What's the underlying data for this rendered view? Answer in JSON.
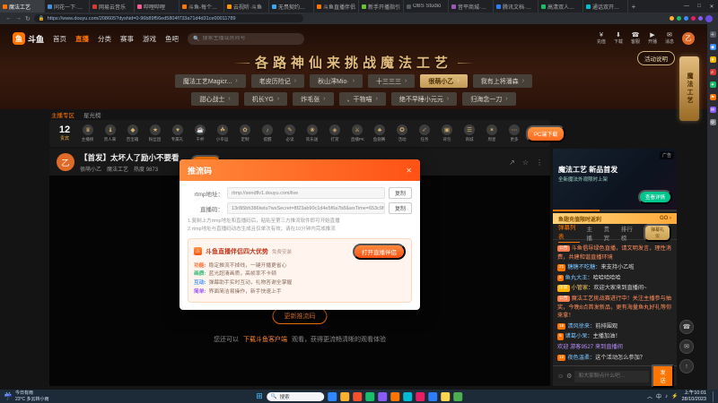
{
  "browser": {
    "tabs": [
      {
        "title": "魔法工艺",
        "color": "#ff7500",
        "active": true
      },
      {
        "title": "同花一下·直播中心",
        "color": "#4a90d9"
      },
      {
        "title": "网易云音乐",
        "color": "#d33a31"
      },
      {
        "title": "哔哩哔哩",
        "color": "#f25d8e"
      },
      {
        "title": "斗鱼-每个人的直播",
        "color": "#ff7500"
      },
      {
        "title": "云视听·斗鱼",
        "color": "#ff9500"
      },
      {
        "title": "无畏契约赛事中心",
        "color": "#3ba3f0"
      },
      {
        "title": "斗鱼直播伴侣",
        "color": "#ff7500"
      },
      {
        "title": "新手开播指引",
        "color": "#67c23a"
      },
      {
        "title": "OBS Studio",
        "color": "#555a60"
      },
      {
        "title": "音平商城·声卡调试",
        "color": "#9b59b6"
      },
      {
        "title": "腾讯文档·值班表",
        "color": "#2e7cf6"
      },
      {
        "title": "高清双人素材(4K)",
        "color": "#19be6b"
      },
      {
        "title": "通话双开模式(48)",
        "color": "#00bcd4"
      }
    ],
    "new_tab": "+",
    "window_controls": [
      "—",
      "□",
      "✕"
    ],
    "address": {
      "back": "←",
      "forward": "→",
      "refresh": "↻",
      "lock": "🔒",
      "url": "https://www.douyu.com/208605?dyshid=0-96b89f56ed5804f733a71d4d31ce00011789"
    },
    "extensions": [
      "#ffb02e",
      "#19be6b",
      "#3b8cff",
      "#e91e63",
      "#8a5cf6"
    ]
  },
  "nav": {
    "logo_glyph": "鱼",
    "logo": "斗鱼",
    "menu": [
      {
        "label": "首页"
      },
      {
        "label": "直播",
        "active": true
      },
      {
        "label": "分类"
      },
      {
        "label": "赛事"
      },
      {
        "label": "游戏"
      },
      {
        "label": "鱼吧"
      }
    ],
    "search_placeholder": "搜索主播或房间号",
    "actions": [
      {
        "label": "充值",
        "glyph": "¥"
      },
      {
        "label": "下载",
        "glyph": "⬇"
      },
      {
        "label": "客服",
        "glyph": "☎"
      },
      {
        "label": "开播",
        "glyph": "▶"
      },
      {
        "label": "消息",
        "glyph": "✉"
      }
    ],
    "avatar": "乙"
  },
  "banner": {
    "title": "各路神仙来挑战魔法工艺",
    "activity_button": "活动说明"
  },
  "anchor_tabs": {
    "row1": [
      {
        "label": "魔法工艺Magicr..."
      },
      {
        "label": "老皮历险记"
      },
      {
        "label": "秋山澪Mio·"
      },
      {
        "label": "十三三三"
      },
      {
        "label": "很萌小乙",
        "active": true
      },
      {
        "label": "我有上将潘森"
      }
    ],
    "row2": [
      {
        "label": "甜心战士"
      },
      {
        "label": "机长YG"
      },
      {
        "label": "炸毛张"
      },
      {
        "label": "、干物喵"
      },
      {
        "label": "绝不早睡小元元"
      },
      {
        "label": "归海念一刀"
      }
    ],
    "arrow": "›"
  },
  "strip": {
    "items": [
      {
        "label": "主播专区",
        "active": true
      },
      {
        "label": "星光榜"
      }
    ]
  },
  "feature_bar": {
    "rank": "12",
    "rank_label": "贵宾",
    "items": [
      {
        "label": "主播榜",
        "glyph": "♛"
      },
      {
        "label": "贵人来",
        "glyph": "♝"
      },
      {
        "label": "百宝箱",
        "glyph": "◆"
      },
      {
        "label": "粉丝团",
        "glyph": "★"
      },
      {
        "label": "专属礼",
        "glyph": "♥"
      },
      {
        "label": "干杯",
        "glyph": "☕"
      },
      {
        "label": "小幸运",
        "glyph": "☘"
      },
      {
        "label": "定制",
        "glyph": "✿"
      },
      {
        "label": "提醒",
        "glyph": "♪"
      },
      {
        "label": "必读",
        "glyph": "✎"
      },
      {
        "label": "欢乐送",
        "glyph": "❀"
      },
      {
        "label": "打赏",
        "glyph": "◈"
      },
      {
        "label": "直播PK",
        "glyph": "⚔"
      },
      {
        "label": "鱼翅赛",
        "glyph": "♣"
      },
      {
        "label": "活动",
        "glyph": "✪"
      },
      {
        "label": "任务",
        "glyph": "✓"
      },
      {
        "label": "背包",
        "glyph": "▣"
      },
      {
        "label": "商城",
        "glyph": "☰"
      },
      {
        "label": "周星",
        "glyph": "✶"
      },
      {
        "label": "更多",
        "glyph": "⋯"
      }
    ],
    "pc_button": "PC端下载"
  },
  "player": {
    "header": {
      "avatar": "乙",
      "title": "【首发】太坏人了励小不要看",
      "follow": "+ 关注",
      "anchor": "很萌小乙",
      "category": "魔法工艺",
      "heat": "热度 9873",
      "tools": [
        {
          "glyph": "↗"
        },
        {
          "glyph": "☆"
        },
        {
          "glyph": "⋮"
        }
      ]
    },
    "offline": {
      "refresh_button": "更新推流码",
      "tip_prefix": "您还可以",
      "tip_link": "下载斗鱼客户端",
      "tip_suffix": "观看，获得更流畅清晰的观看体验"
    }
  },
  "modal": {
    "title": "推流码",
    "close": "✕",
    "fields": [
      {
        "label": "rtmp地址：",
        "value": "rtmp://sendflv1.douyu.com/live",
        "copy": "复制"
      },
      {
        "label": "直播码：",
        "value": "13r8i5bh386twtu?wsSecret=8f23ab90c1d4e5f6a7b8&wsTime=653c9f2e",
        "copy": "复制"
      }
    ],
    "tips": [
      "1.复制上方rtmp地址和直播码后，粘贴至第三方推流软件即可开始直播",
      "2.rtmp地址与直播码动态生成且仅单次有效，请在10分钟内完成推流"
    ],
    "promo": {
      "flame": "♨",
      "title": "斗鱼直播伴侣四大优势",
      "subtitle": "免费安装",
      "button": "打开直播伴侣",
      "lines": [
        {
          "tag": "功能:",
          "color": "#ff6a2b",
          "text": "稳定推流不掉线，一键开播更省心"
        },
        {
          "tag": "画质:",
          "color": "#2eb872",
          "text": "蓝光超清画质，高帧率不卡顿"
        },
        {
          "tag": "互动:",
          "color": "#3b8cff",
          "text": "弹幕助手实时互动，礼物答谢全掌握"
        },
        {
          "tag": "简单:",
          "color": "#a45bff",
          "text": "界面简洁易操作，新手快速上手"
        }
      ]
    }
  },
  "sidebar": {
    "ad": {
      "badge": "广告",
      "title": "魔法工艺 新品首发",
      "subtitle": "全新魔法外观限时上架",
      "cta": "查看详情",
      "progress_style": "width:38%"
    },
    "promo_bar": {
      "text": "鱼翅充值限时返利",
      "cta": "GO ›"
    },
    "tabs": [
      {
        "label": "弹幕列表",
        "active": true
      },
      {
        "label": "主播"
      },
      {
        "label": "贵宾"
      },
      {
        "label": "排行榜"
      }
    ],
    "etiquette_button": "弹幕礼仪",
    "messages": [
      {
        "badge": "公告",
        "badgeBg": "#ff7d4c",
        "name": "",
        "nameColor": "#ff8d5a",
        "text": "斗鱼倡导绿色直播，请文明发言，理性消费，共建和谐直播环境",
        "textColor": "#ff8d5a"
      },
      {
        "badge": "21",
        "badgeBg": "#ff7500",
        "name": "糖糖不吃糖：",
        "nameColor": "#7ac6ff",
        "text": "来支持小乙啦",
        "textColor": "#dddddd"
      },
      {
        "badge": "8",
        "badgeBg": "#ff7500",
        "name": "鱼丸大王：",
        "nameColor": "#7ac6ff",
        "text": "哈哈哈哈哈",
        "textColor": "#dddddd"
      },
      {
        "badge": "房管",
        "badgeBg": "#ffb400",
        "name": "小管家：",
        "nameColor": "#ffc966",
        "text": "欢迎大家来到直播间~",
        "textColor": "#dddddd"
      },
      {
        "badge": "公告",
        "badgeBg": "#ff7d4c",
        "name": "",
        "nameColor": "#ff8d5a",
        "text": "魔法工艺挑战赛进行中！关注主播参与抽奖，今晚8点首发新品，更有海量鱼丸好礼等你来拿！",
        "textColor": "#ff8d5a"
      },
      {
        "badge": "15",
        "badgeBg": "#ff7500",
        "name": "清风徐来：",
        "nameColor": "#7ac6ff",
        "text": "前排围观",
        "textColor": "#dddddd"
      },
      {
        "badge": "5",
        "badgeBg": "#ff7500",
        "name": "诸葛小呆：",
        "nameColor": "#7ac6ff",
        "text": "主播加油！",
        "textColor": "#dddddd"
      },
      {
        "badge": "",
        "badgeBg": null,
        "name": "",
        "nameColor": "#b98fff",
        "text": "欢迎 游客9527 来到直播间",
        "textColor": "#b98fff"
      },
      {
        "badge": "12",
        "badgeBg": "#ff7500",
        "name": "夜色温柔：",
        "nameColor": "#7ac6ff",
        "text": "这个活动怎么参加？",
        "textColor": "#dddddd"
      }
    ],
    "input": {
      "emoji": "☺",
      "settings": "⚙",
      "placeholder": "和大家聊点什么吧…",
      "send": "发送"
    }
  },
  "right_rail": {
    "event_banner": "魔法工艺",
    "floats": [
      {
        "glyph": "☎"
      },
      {
        "glyph": "✉"
      },
      {
        "glyph": "↑"
      }
    ]
  },
  "edge_sidebar": {
    "icons": [
      {
        "glyph": "＋",
        "color": "#5a5d63"
      },
      {
        "glyph": "◉",
        "color": "#3b8cff"
      },
      {
        "glyph": "★",
        "color": "#f7b500"
      },
      {
        "glyph": "♬",
        "color": "#d33a31"
      },
      {
        "glyph": "✦",
        "color": "#19be6b"
      },
      {
        "glyph": "⚑",
        "color": "#ff7500"
      },
      {
        "glyph": "✉",
        "color": "#8a5cf6"
      },
      {
        "glyph": "⚙",
        "color": "#7f858c"
      }
    ]
  },
  "taskbar": {
    "weather": {
      "glyph": "☔",
      "line1": "今日有雨",
      "line2": "23°C 多云转小雨"
    },
    "start_glyph": "⊞",
    "search_glyph": "🔍",
    "search_label": "搜索",
    "apps": [
      "#2f88ff",
      "#ffb02e",
      "#f4512c",
      "#19be6b",
      "#8a5cf6",
      "#ff7500",
      "#00bcd4",
      "#e91e63",
      "#2e7cf6",
      "#ffd54f",
      "#4caf50"
    ],
    "tray": {
      "chevron": "︿",
      "lang": "中",
      "icons": [
        {
          "glyph": "♪"
        },
        {
          "glyph": "⚡"
        }
      ],
      "time": "上午10:01",
      "date": "28/10/2023"
    }
  }
}
